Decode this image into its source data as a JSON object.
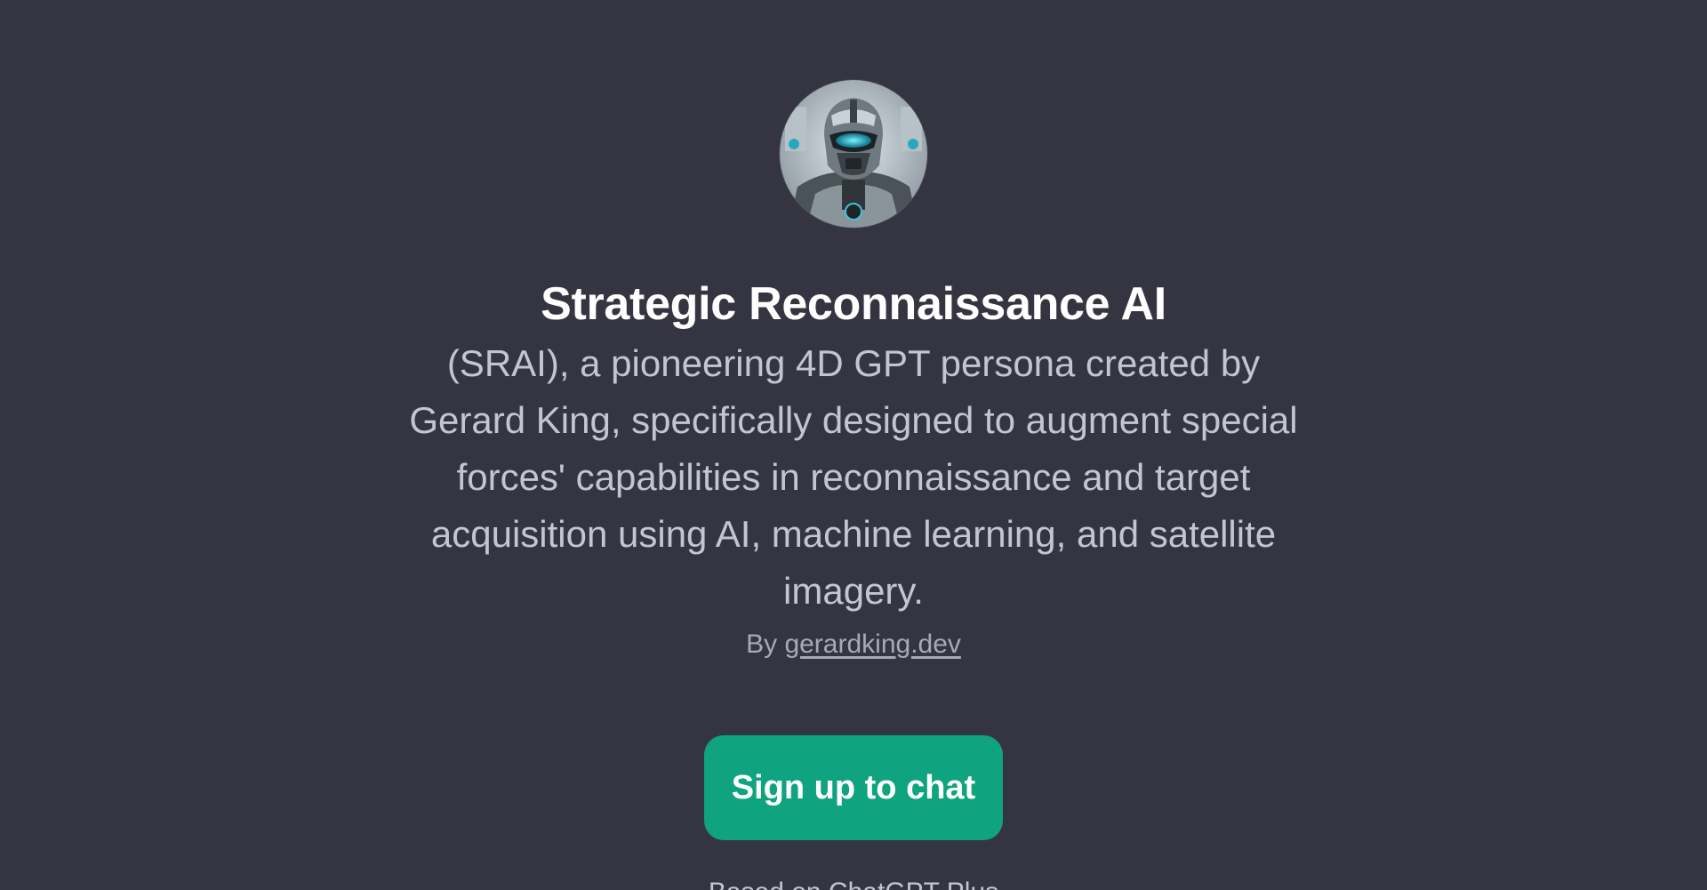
{
  "gpt": {
    "avatar_icon": "robot-soldier-avatar",
    "title": "Strategic Reconnaissance AI",
    "description": "(SRAI), a pioneering 4D GPT persona created by Gerard King, specifically designed to augment special forces' capabilities in reconnaissance and target acquisition using AI, machine learning, and satellite imagery.",
    "by_prefix": "By",
    "author_link": "gerardking.dev"
  },
  "actions": {
    "signup_label": "Sign up to chat"
  },
  "footer": {
    "note": "Based on ChatGPT Plus"
  },
  "colors": {
    "background": "#343541",
    "title": "#ffffff",
    "description": "#c5c5d2",
    "byline": "#a9a9b6",
    "button": "#10a37f",
    "button_text": "#ffffff"
  }
}
